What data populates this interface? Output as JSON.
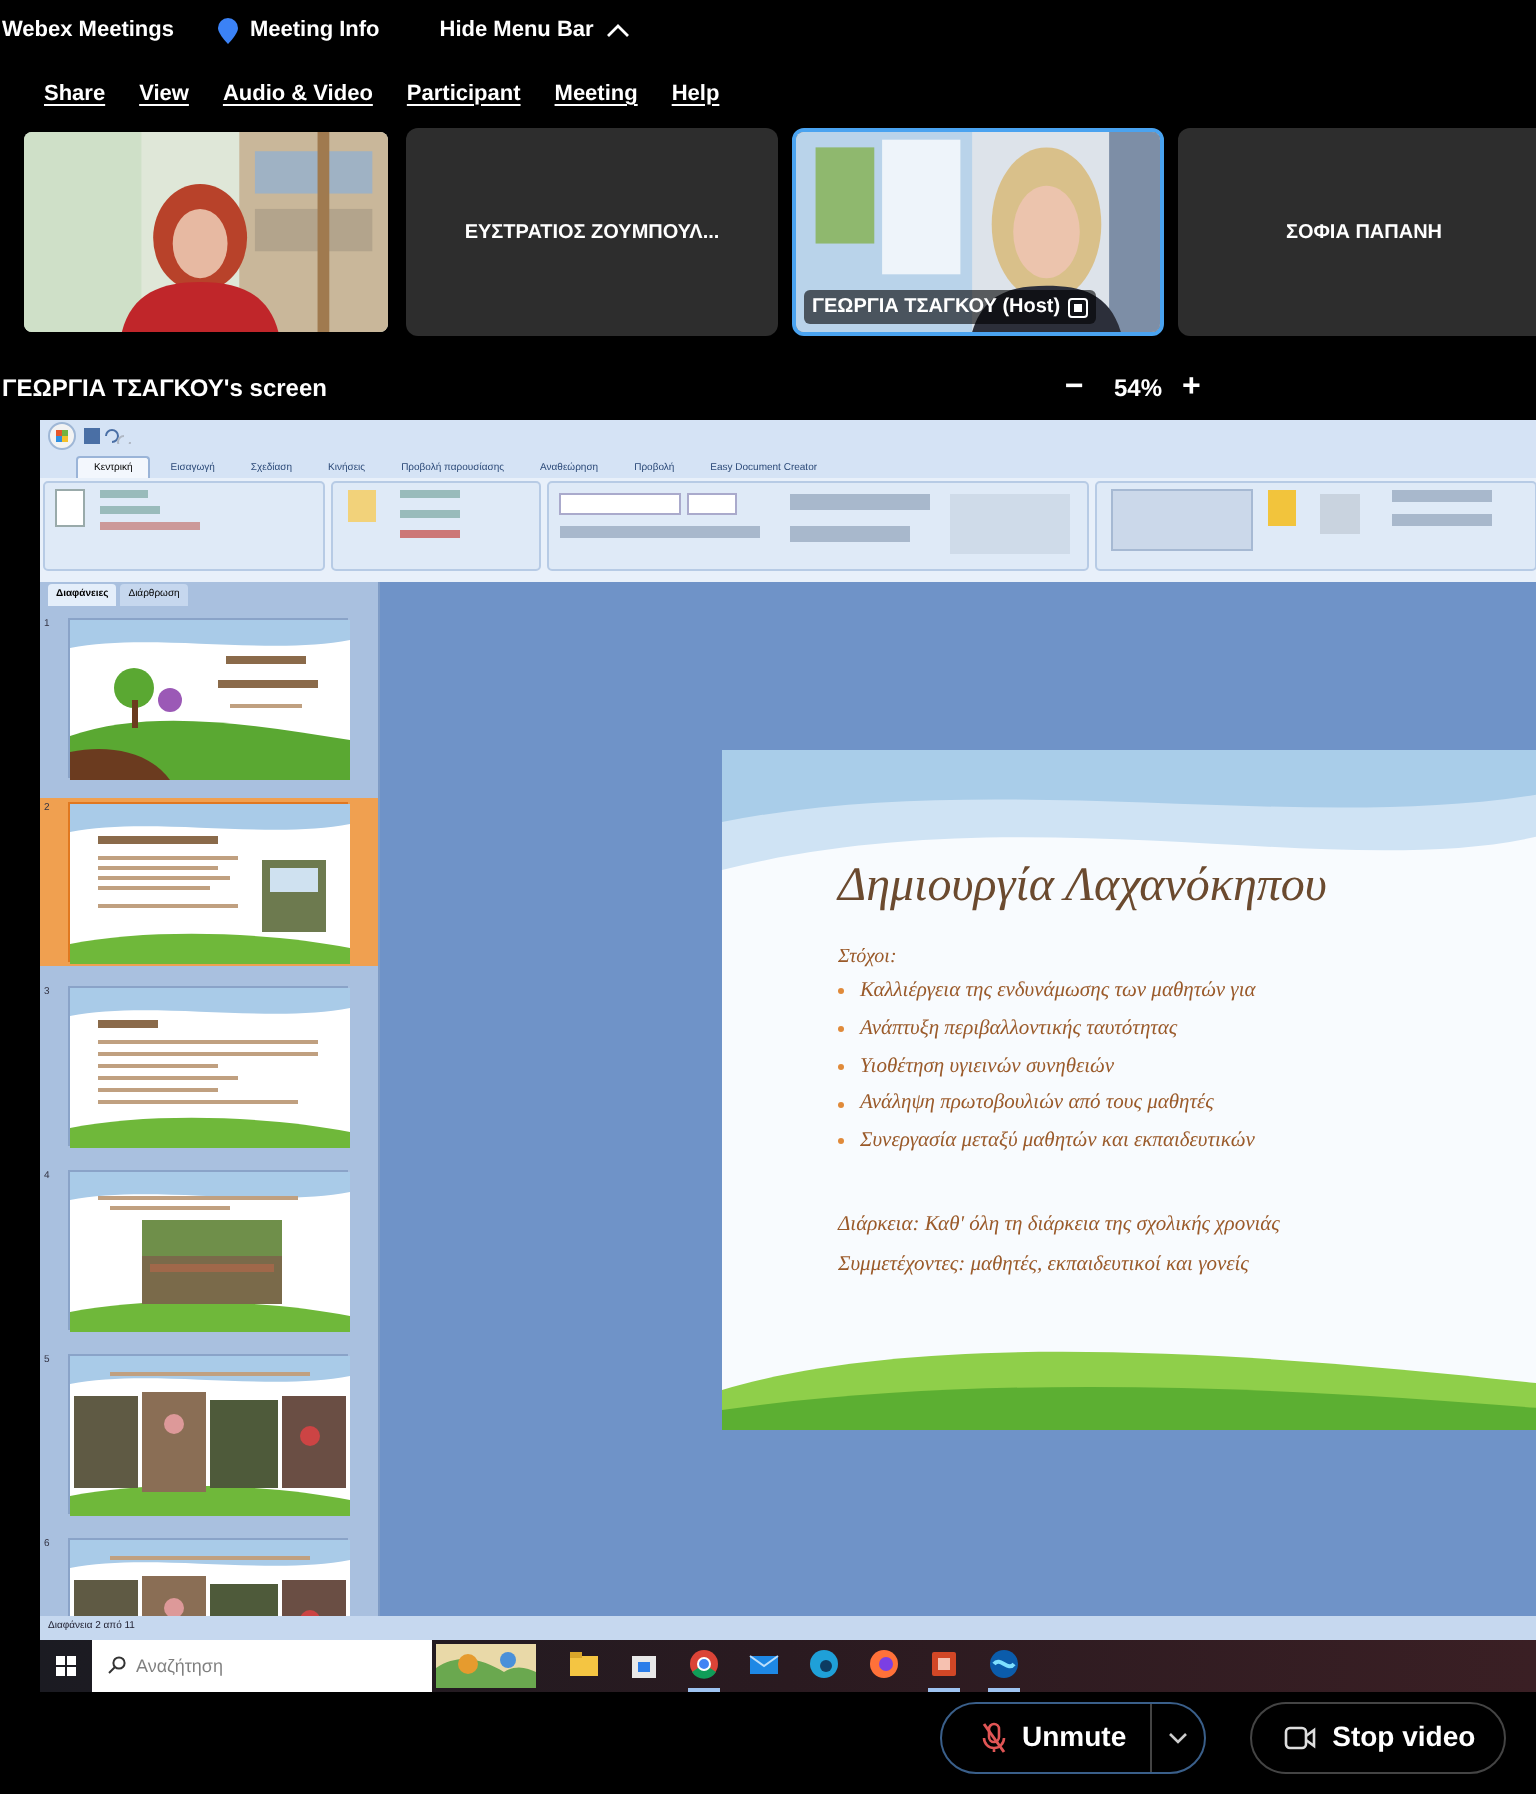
{
  "menu_bar": {
    "app": "Webex Meetings",
    "info": "Meeting Info",
    "hide": "Hide Menu Bar"
  },
  "menus": [
    "Share",
    "View",
    "Audio & Video",
    "Participant",
    "Meeting",
    "Help"
  ],
  "participants": [
    {
      "kind": "video",
      "selected": false
    },
    {
      "kind": "name",
      "name": "ΕΥΣΤΡΑΤΙΟΣ ΖΟΥΜΠΟΥΛ...",
      "selected": false
    },
    {
      "kind": "video",
      "name": "ΓΕΩΡΓΙΑ ΤΣΑΓΚΟΥ (Host)",
      "selected": true
    },
    {
      "kind": "name",
      "name": "ΣΟΦΙΑ ΠΑΠΑΝΗ",
      "selected": false
    }
  ],
  "share": {
    "label": "ΓΕΩΡΓΙΑ ΤΣΑΓΚΟΥ's screen",
    "zoom_out": "−",
    "zoom": "54%",
    "zoom_in": "+"
  },
  "powerpoint": {
    "tabs": [
      {
        "label": "Κεντρική",
        "selected": true
      },
      {
        "label": "Εισαγωγή",
        "selected": false
      },
      {
        "label": "Σχεδίαση",
        "selected": false
      },
      {
        "label": "Κινήσεις",
        "selected": false
      },
      {
        "label": "Προβολή παρουσίασης",
        "selected": false
      },
      {
        "label": "Αναθεώρηση",
        "selected": false
      },
      {
        "label": "Προβολή",
        "selected": false
      },
      {
        "label": "Easy Document Creator",
        "selected": false
      }
    ],
    "pane_tabs": [
      {
        "label": "Διαφάνειες",
        "selected": true
      },
      {
        "label": "Διάρθρωση",
        "selected": false
      }
    ],
    "thumbnails": [
      {
        "number": "1",
        "kind": "title",
        "selected": false
      },
      {
        "number": "2",
        "kind": "text",
        "selected": true
      },
      {
        "number": "3",
        "kind": "list",
        "selected": false
      },
      {
        "number": "4",
        "selected": false
      },
      {
        "number": "5",
        "kind": "photos",
        "selected": false
      },
      {
        "number": "6",
        "kind": "photos",
        "selected": false
      }
    ],
    "slide": {
      "title": "Δημιουργία Λαχανόκηπου",
      "heading": "Στόχοι:",
      "bullets": [
        "Καλλιέργεια της ενδυνάμωσης των μαθητών για",
        "Ανάπτυξη περιβαλλοντικής ταυτότητας",
        "Υιοθέτηση υγιεινών συνηθειών",
        "Ανάληψη πρωτοβουλιών από τους μαθητές",
        "Συνεργασία μεταξύ μαθητών και εκπαιδευτικών"
      ],
      "notes": [
        "Διάρκεια: Καθ' όλη τη διάρκεια της σχολικής χρονιάς",
        "Συμμετέχοντες: μαθητές, εκπαιδευτικοί και γονείς"
      ]
    },
    "status": "Διαφάνεια 2 από 11"
  },
  "taskbar": {
    "search_placeholder": "Αναζήτηση",
    "apps": [
      {
        "kind": "folder",
        "selected": false
      },
      {
        "kind": "store",
        "selected": false
      },
      {
        "kind": "chrome",
        "selected": true
      },
      {
        "kind": "mail",
        "selected": false
      },
      {
        "kind": "edge",
        "selected": false
      },
      {
        "kind": "firefox",
        "selected": false
      },
      {
        "kind": "powerpoint",
        "selected": true
      },
      {
        "kind": "webex",
        "selected": true
      }
    ]
  },
  "controls": [
    {
      "kind": "mute",
      "label": "Unmute"
    },
    {
      "kind": "video",
      "label": "Stop video"
    }
  ]
}
